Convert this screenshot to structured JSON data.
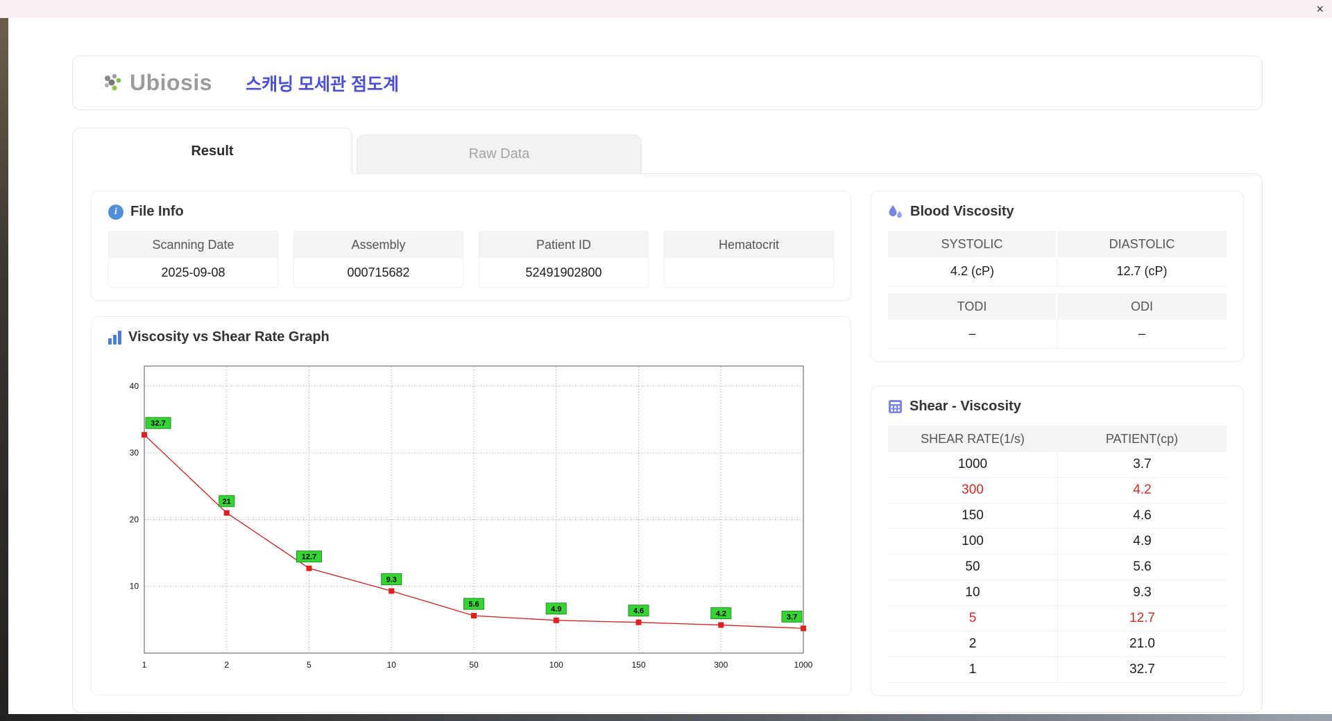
{
  "window": {
    "close_label": "×"
  },
  "header": {
    "logo_text": "Ubiosis",
    "app_title": "스캐닝 모세관 점도계"
  },
  "tabs": [
    {
      "label": "Result",
      "active": true
    },
    {
      "label": "Raw Data",
      "active": false
    }
  ],
  "file_info": {
    "title": "File Info",
    "fields": [
      {
        "label": "Scanning Date",
        "value": "2025-09-08"
      },
      {
        "label": "Assembly",
        "value": "000715682"
      },
      {
        "label": "Patient ID",
        "value": "52491902800"
      },
      {
        "label": "Hematocrit",
        "value": ""
      }
    ]
  },
  "blood_viscosity": {
    "title": "Blood Viscosity",
    "systolic": {
      "label": "SYSTOLIC",
      "value": "4.2 (cP)"
    },
    "diastolic": {
      "label": "DIASTOLIC",
      "value": "12.7 (cP)"
    },
    "todi": {
      "label": "TODI",
      "value": "–"
    },
    "odi": {
      "label": "ODI",
      "value": "–"
    }
  },
  "shear_viscosity": {
    "title": "Shear - Viscosity",
    "columns": [
      "SHEAR RATE(1/s)",
      "PATIENT(cp)"
    ],
    "rows": [
      {
        "shear": "1000",
        "patient": "3.7",
        "highlight": false
      },
      {
        "shear": "300",
        "patient": "4.2",
        "highlight": true
      },
      {
        "shear": "150",
        "patient": "4.6",
        "highlight": false
      },
      {
        "shear": "100",
        "patient": "4.9",
        "highlight": false
      },
      {
        "shear": "50",
        "patient": "5.6",
        "highlight": false
      },
      {
        "shear": "10",
        "patient": "9.3",
        "highlight": false
      },
      {
        "shear": "5",
        "patient": "12.7",
        "highlight": true
      },
      {
        "shear": "2",
        "patient": "21.0",
        "highlight": false
      },
      {
        "shear": "1",
        "patient": "32.7",
        "highlight": false
      }
    ]
  },
  "graph": {
    "title": "Viscosity vs Shear Rate Graph",
    "chart_data": {
      "type": "line",
      "x": [
        1,
        2,
        5,
        10,
        50,
        100,
        150,
        300,
        1000
      ],
      "x_ticks": [
        "1",
        "2",
        "5",
        "10",
        "50",
        "100",
        "150",
        "300",
        "1000"
      ],
      "values": [
        32.7,
        21,
        12.7,
        9.3,
        5.6,
        4.9,
        4.6,
        4.2,
        3.7
      ],
      "labels": [
        "32.7",
        "21",
        "12.7",
        "9.3",
        "5.6",
        "4.9",
        "4.6",
        "4.2",
        "3.7"
      ],
      "y_ticks": [
        10,
        20,
        30,
        40
      ],
      "ylim": [
        0,
        43
      ],
      "x_axis_type": "category",
      "grid": "dotted",
      "line_color": "#cc2222",
      "marker_color": "#e02020",
      "label_bg": "#35d435",
      "label_border": "#1f8f1f"
    }
  }
}
